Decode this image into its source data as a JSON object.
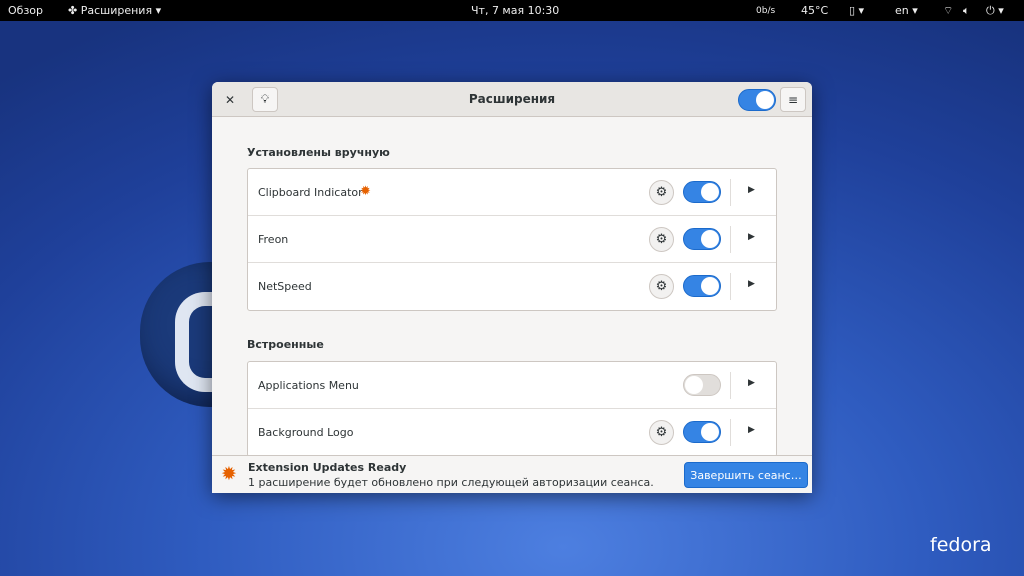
{
  "topbar": {
    "activities": "Обзор",
    "app_menu": "Расширения",
    "clock": "Чт, 7 мая  10:30",
    "netspeed": "0b/s",
    "temp": "45°C",
    "lang": "en"
  },
  "window": {
    "title": "Расширения",
    "manual_section": "Установлены вручную",
    "builtin_section": "Встроенные",
    "manual": [
      {
        "name": "Clipboard Indicator",
        "update": true,
        "enabled": true
      },
      {
        "name": "Freon",
        "enabled": true
      },
      {
        "name": "NetSpeed",
        "enabled": true
      }
    ],
    "builtin": [
      {
        "name": "Applications Menu",
        "enabled": false
      },
      {
        "name": "Background Logo",
        "enabled": true
      }
    ],
    "global_enabled": true
  },
  "footer": {
    "title": "Extension Updates Ready",
    "message": "1 расширение будет обновлено при следующей авторизации сеанса.",
    "button": "Завершить сеанс…"
  },
  "desktop": {
    "brand": "fedora"
  }
}
